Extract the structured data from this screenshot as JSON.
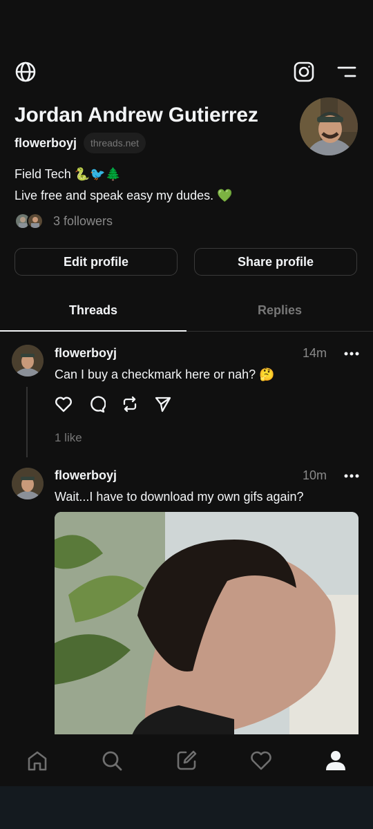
{
  "profile": {
    "name": "Jordan Andrew Gutierrez",
    "handle": "flowerboyj",
    "domain": "threads.net",
    "bio_line1": "Field Tech 🐍🐦🌲",
    "bio_line2": "Live free and speak easy my dudes. 💚",
    "followers": "3 followers"
  },
  "buttons": {
    "edit": "Edit profile",
    "share": "Share profile"
  },
  "tabs": {
    "threads": "Threads",
    "replies": "Replies",
    "active": "Threads"
  },
  "posts": [
    {
      "handle": "flowerboyj",
      "time": "14m",
      "text": "Can I buy a checkmark here or nah? 🤔",
      "likes": "1 like"
    },
    {
      "handle": "flowerboyj",
      "time": "10m",
      "text": "Wait...I have to download my own gifs again?"
    }
  ],
  "icons": {
    "header_left": "globe-icon",
    "header_right": [
      "instagram-icon",
      "menu-icon"
    ],
    "post_actions": [
      "heart-icon",
      "comment-icon",
      "repost-icon",
      "share-icon"
    ],
    "nav": [
      "home-icon",
      "search-icon",
      "compose-icon",
      "activity-heart-icon",
      "profile-icon"
    ]
  },
  "colors": {
    "background": "#101010",
    "text": "#f3f5f7",
    "muted": "#8a8a8a",
    "border": "#3b3b3b"
  }
}
